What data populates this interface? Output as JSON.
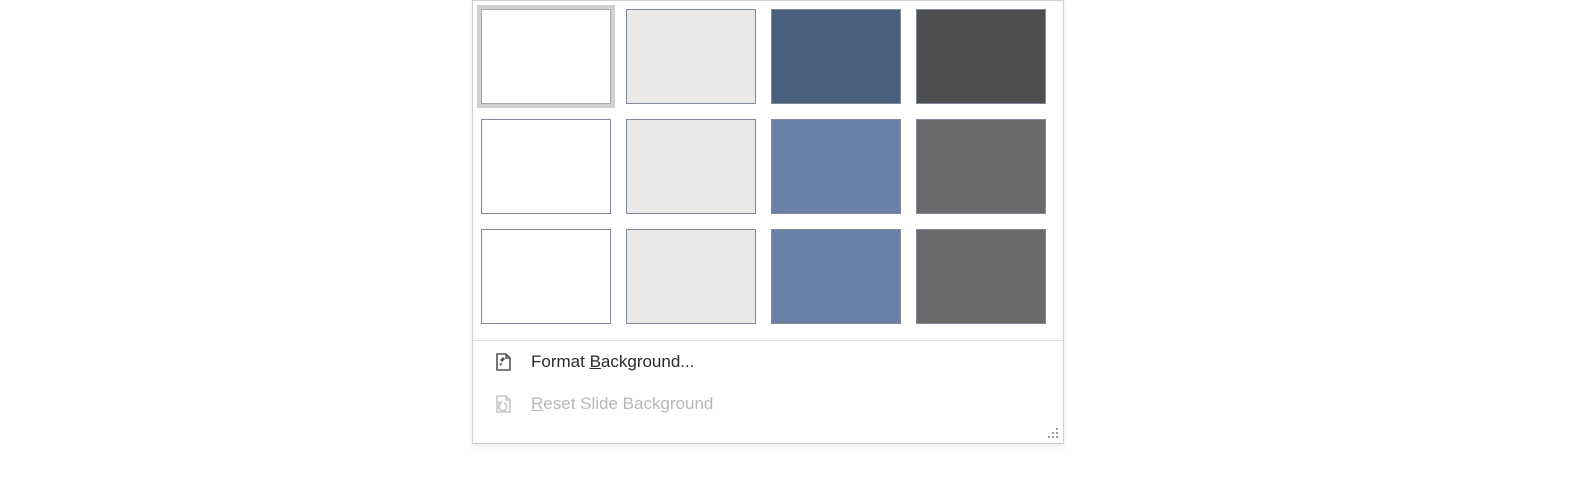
{
  "background_styles": {
    "rows": [
      [
        {
          "name": "style-1-1",
          "color": "#ffffff",
          "selected": true
        },
        {
          "name": "style-1-2",
          "color": "#ebe9e7",
          "selected": false
        },
        {
          "name": "style-1-3",
          "color": "#4a5f7e",
          "selected": false
        },
        {
          "name": "style-1-4",
          "color": "#4f4f4f",
          "selected": false
        }
      ],
      [
        {
          "name": "style-2-1",
          "color": "#ffffff",
          "selected": false
        },
        {
          "name": "style-2-2",
          "color": "#ebe9e7",
          "selected": false
        },
        {
          "name": "style-2-3",
          "color": "#6a80a6",
          "selected": false
        },
        {
          "name": "style-2-4",
          "color": "#6a6a6a",
          "selected": false
        }
      ],
      [
        {
          "name": "style-3-1",
          "color": "#ffffff",
          "selected": false
        },
        {
          "name": "style-3-2",
          "color": "#ebe9e7",
          "selected": false
        },
        {
          "name": "style-3-3",
          "color": "#6a80a6",
          "selected": false
        },
        {
          "name": "style-3-4",
          "color": "#6a6a6a",
          "selected": false
        }
      ]
    ]
  },
  "menu": {
    "format_background": {
      "label_pre": "Format ",
      "label_accel": "B",
      "label_post": "ackground...",
      "enabled": true
    },
    "reset_background": {
      "label_pre": "",
      "label_accel": "R",
      "label_post": "eset Slide Background",
      "enabled": false
    }
  }
}
